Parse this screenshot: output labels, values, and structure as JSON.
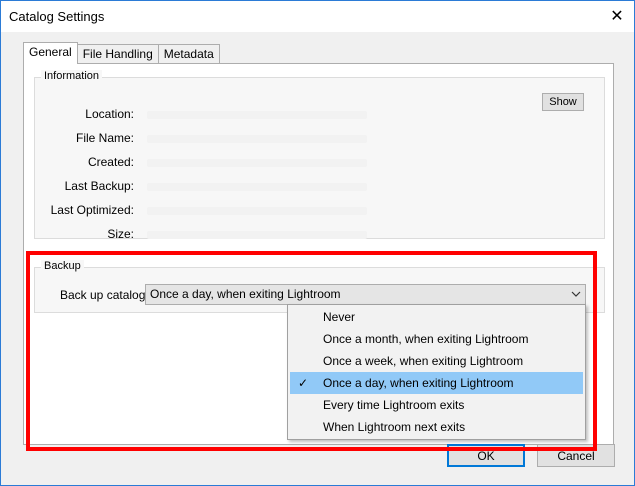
{
  "window": {
    "title": "Catalog Settings",
    "close_glyph": "✕"
  },
  "tabs": [
    {
      "label": "General",
      "active": true
    },
    {
      "label": "File Handling",
      "active": false
    },
    {
      "label": "Metadata",
      "active": false
    }
  ],
  "information": {
    "legend": "Information",
    "rows": [
      {
        "label": "Location:"
      },
      {
        "label": "File Name:"
      },
      {
        "label": "Created:"
      },
      {
        "label": "Last Backup:"
      },
      {
        "label": "Last Optimized:"
      },
      {
        "label": "Size:"
      }
    ],
    "show_button": "Show"
  },
  "backup": {
    "legend": "Backup",
    "label": "Back up catalog:",
    "selected": "Once a day, when exiting Lightroom",
    "chevron_icon": "chevron-down-icon",
    "options": [
      {
        "label": "Never",
        "checked": false
      },
      {
        "label": "Once a month, when exiting Lightroom",
        "checked": false
      },
      {
        "label": "Once a week, when exiting Lightroom",
        "checked": false
      },
      {
        "label": "Once a day, when exiting Lightroom",
        "checked": true
      },
      {
        "label": "Every time Lightroom exits",
        "checked": false
      },
      {
        "label": "When Lightroom next exits",
        "checked": false
      }
    ],
    "check_glyph": "✓"
  },
  "footer": {
    "ok_label": "OK",
    "cancel_label": "Cancel"
  },
  "colors": {
    "highlight": "#ff0000",
    "selected_item": "#91c9f7",
    "accent": "#0078d7"
  }
}
